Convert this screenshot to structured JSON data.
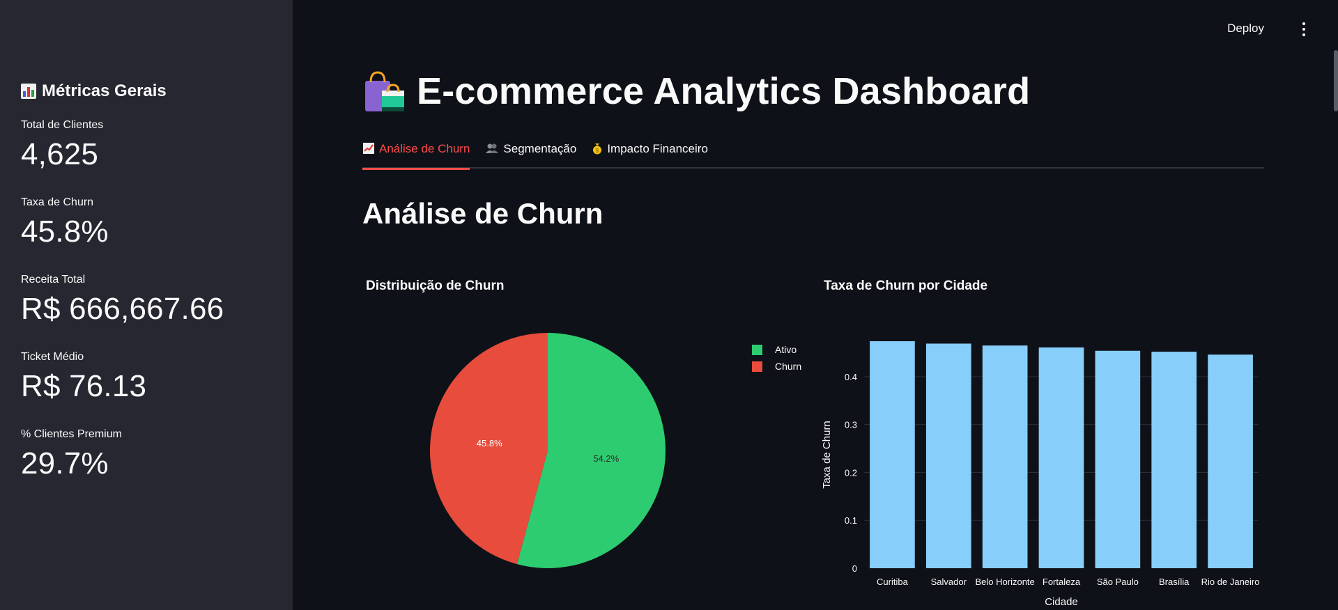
{
  "sidebar": {
    "title": "Métricas Gerais",
    "metrics": [
      {
        "label": "Total de Clientes",
        "value": "4,625"
      },
      {
        "label": "Taxa de Churn",
        "value": "45.8%"
      },
      {
        "label": "Receita Total",
        "value": "R$ 666,667.66"
      },
      {
        "label": "Ticket Médio",
        "value": "R$ 76.13"
      },
      {
        "label": "% Clientes Premium",
        "value": "29.7%"
      }
    ]
  },
  "header": {
    "deploy_label": "Deploy"
  },
  "main": {
    "title": "E-commerce Analytics Dashboard",
    "tabs": [
      {
        "label": "Análise de Churn",
        "icon": "chart-increasing-icon"
      },
      {
        "label": "Segmentação",
        "icon": "people-icon"
      },
      {
        "label": "Impacto Financeiro",
        "icon": "money-bag-icon"
      }
    ],
    "section_title": "Análise de Churn"
  },
  "colors": {
    "accent": "#ff4b4b",
    "ativo": "#2ecc71",
    "churn": "#e74c3c",
    "bar": "#87cefa"
  },
  "chart_data": [
    {
      "type": "pie",
      "title": "Distribuição de Churn",
      "labels": [
        "Ativo",
        "Churn"
      ],
      "values": [
        54.2,
        45.8
      ],
      "value_labels": [
        "54.2%",
        "45.8%"
      ],
      "colors": [
        "#2ecc71",
        "#e74c3c"
      ],
      "legend": "top-right"
    },
    {
      "type": "bar",
      "title": "Taxa de Churn por Cidade",
      "categories": [
        "Curitiba",
        "Salvador",
        "Belo Horizonte",
        "Fortaleza",
        "São Paulo",
        "Brasília",
        "Rio de Janeiro"
      ],
      "values": [
        0.474,
        0.469,
        0.465,
        0.461,
        0.454,
        0.452,
        0.446
      ],
      "xlabel": "Cidade",
      "ylabel": "Taxa de Churn",
      "ylim": [
        0,
        0.474
      ],
      "yticks": [
        "0",
        "0.1",
        "0.2",
        "0.3",
        "0.4"
      ],
      "grid": true
    }
  ]
}
